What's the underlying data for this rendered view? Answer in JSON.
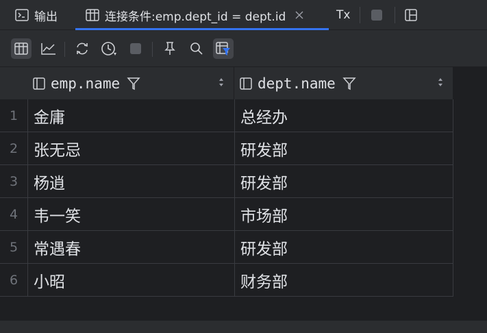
{
  "tabs": {
    "output_label": "输出",
    "query_label": "连接条件:emp.dept_id = dept.id",
    "tx_label": "Tx"
  },
  "toolbar": {
    "items": [
      "table-view",
      "chart-view",
      "refresh",
      "history",
      "stop",
      "pin",
      "search",
      "filter-view"
    ],
    "active": [
      "table-view",
      "filter-view"
    ]
  },
  "columns": [
    {
      "label": "emp.name"
    },
    {
      "label": "dept.name"
    }
  ],
  "rows": [
    {
      "num": "1",
      "emp": "金庸",
      "dept": "总经办"
    },
    {
      "num": "2",
      "emp": "张无忌",
      "dept": "研发部"
    },
    {
      "num": "3",
      "emp": "杨逍",
      "dept": "研发部"
    },
    {
      "num": "4",
      "emp": "韦一笑",
      "dept": "市场部"
    },
    {
      "num": "5",
      "emp": "常遇春",
      "dept": "研发部"
    },
    {
      "num": "6",
      "emp": "小昭",
      "dept": "财务部"
    }
  ],
  "colors": {
    "background": "#1e1f22",
    "panel": "#2b2d30",
    "accent": "#3574f0",
    "text": "#dfe1e5"
  }
}
